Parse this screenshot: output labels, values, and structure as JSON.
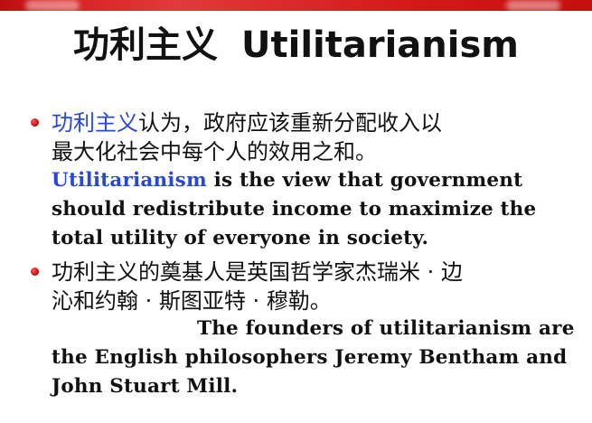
{
  "colors": {
    "accent": "#2a47d8",
    "bullet": "#c40000",
    "top_bar": "#d41818",
    "text": "#111111"
  },
  "title": {
    "cn": "功利主义",
    "en": "Utilitarianism"
  },
  "bullet1": {
    "cn_highlight": "功利主义",
    "cn_line1_rest": "认为，政府应该重新分配收入以",
    "cn_line2": "最大化社会中每个人的效用之和。",
    "en_highlight": "Utilitarianism",
    "en_line1_rest": " is the view that government",
    "en_line2": "should redistribute income to maximize the",
    "en_line3": "total utility of everyone in society."
  },
  "bullet2": {
    "cn_line1": "功利主义的奠基人是英国哲学家杰瑞米 · 边",
    "cn_line2": "沁和约翰 · 斯图亚特 · 穆勒。",
    "en_line1": "The founders of utilitarianism are",
    "en_line2": "the English philosophers Jeremy Bentham and",
    "en_line3": "John Stuart Mill."
  }
}
